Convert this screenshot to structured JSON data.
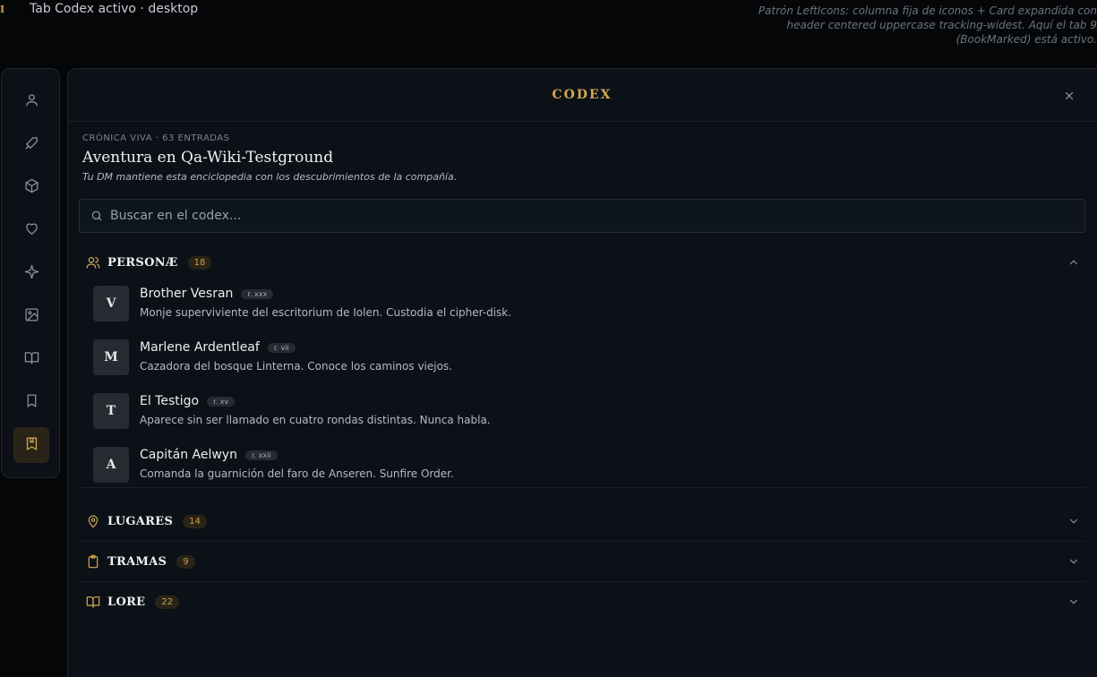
{
  "top": {
    "mark": "I",
    "title": "Tab Codex activo · desktop",
    "note": "Patrón LeftIcons: columna fija de iconos + Card expandida con header centered uppercase tracking-widest. Aquí el tab 9 (BookMarked) está activo."
  },
  "rail": {
    "items": [
      {
        "icon": "user-icon",
        "active": false
      },
      {
        "icon": "sword-icon",
        "active": false
      },
      {
        "icon": "box-icon",
        "active": false
      },
      {
        "icon": "heart-icon",
        "active": false
      },
      {
        "icon": "sparkle-icon",
        "active": false
      },
      {
        "icon": "image-icon",
        "active": false
      },
      {
        "icon": "book-open-icon",
        "active": false
      },
      {
        "icon": "bookmark-icon",
        "active": false
      },
      {
        "icon": "book-marked-icon",
        "active": true
      }
    ]
  },
  "card": {
    "title": "CODEX",
    "eyebrow": "CRÓNICA VIVA · 63 ENTRADAS",
    "headline": "Aventura en Qa-Wiki-Testground",
    "subline": "Tu DM mantiene esta enciclopedia con los descubrimientos de la compañía.",
    "search_placeholder": "Buscar en el codex..."
  },
  "sections": [
    {
      "label": "PERSONÆ",
      "count": "18",
      "icon": "users-icon",
      "expanded": true,
      "entries": [
        {
          "initial": "V",
          "name": "Brother Vesran",
          "rank": "r. xxx",
          "desc": "Monje superviviente del escritorium de Iolen. Custodia el cipher-disk."
        },
        {
          "initial": "M",
          "name": "Marlene Ardentleaf",
          "rank": "r. vii",
          "desc": "Cazadora del bosque Linterna. Conoce los caminos viejos."
        },
        {
          "initial": "T",
          "name": "El Testigo",
          "rank": "r. xv",
          "desc": "Aparece sin ser llamado en cuatro rondas distintas. Nunca habla."
        },
        {
          "initial": "A",
          "name": "Capitán Aelwyn",
          "rank": "r. xxii",
          "desc": "Comanda la guarnición del faro de Anseren. Sunfire Order."
        }
      ]
    },
    {
      "label": "LUGARES",
      "count": "14",
      "icon": "map-pin-icon",
      "expanded": false
    },
    {
      "label": "TRAMAS",
      "count": "9",
      "icon": "clipboard-icon",
      "expanded": false
    },
    {
      "label": "LORE",
      "count": "22",
      "icon": "book-open-icon",
      "expanded": false
    }
  ]
}
